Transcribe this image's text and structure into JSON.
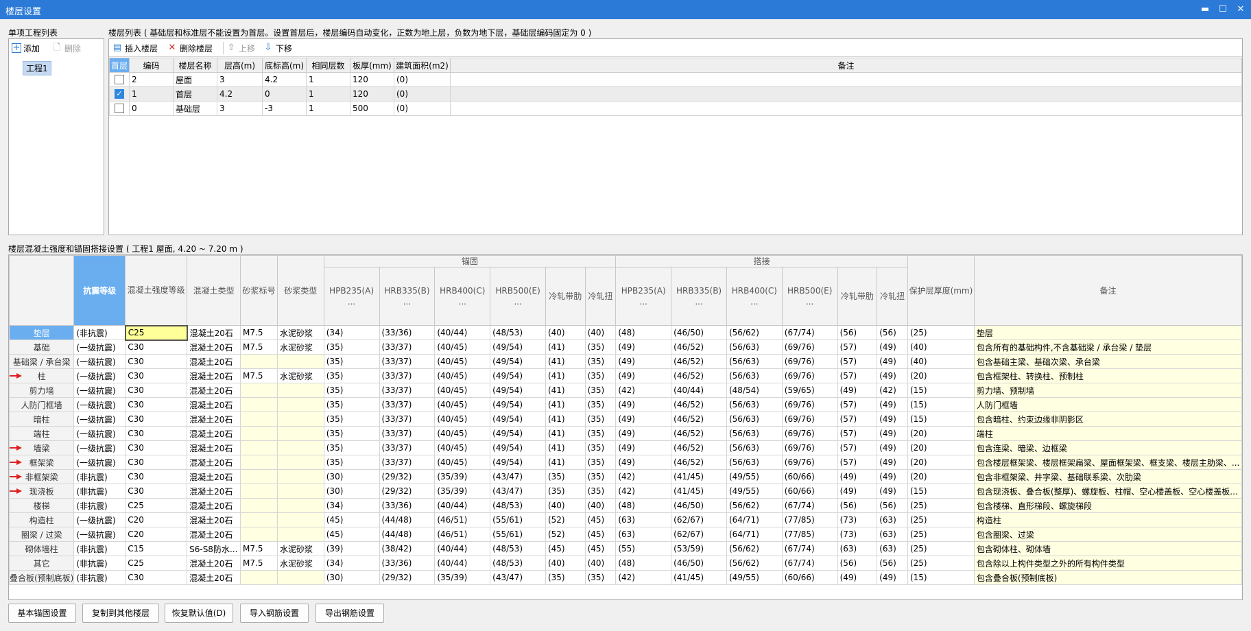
{
  "window": {
    "title": "楼层设置",
    "min": "▬",
    "max": "☐",
    "close": "✕"
  },
  "left": {
    "title": "单项工程列表",
    "add": "添加",
    "delete": "删除",
    "project": "工程1"
  },
  "upper": {
    "title": "楼层列表 ( 基础层和标准层不能设置为首层。设置首层后，楼层编码自动变化，正数为地上层，负数为地下层，基础层编码固定为 0 )",
    "insert": "插入楼层",
    "remove": "删除楼层",
    "up": "上移",
    "down": "下移",
    "columns": [
      "首层",
      "编码",
      "楼层名称",
      "层高(m)",
      "底标高(m)",
      "相同层数",
      "板厚(mm)",
      "建筑面积(m2)",
      "备注"
    ],
    "rows": [
      {
        "checked": false,
        "code": "2",
        "name": "屋面",
        "height": "3",
        "bottom": "4.2",
        "same": "1",
        "slab": "120",
        "area": "(0)",
        "note": ""
      },
      {
        "checked": true,
        "code": "1",
        "name": "首层",
        "height": "4.2",
        "bottom": "0",
        "same": "1",
        "slab": "120",
        "area": "(0)",
        "note": ""
      },
      {
        "checked": false,
        "code": "0",
        "name": "基础层",
        "height": "3",
        "bottom": "-3",
        "same": "1",
        "slab": "500",
        "area": "(0)",
        "note": ""
      }
    ]
  },
  "lower": {
    "title": "楼层混凝土强度和锚固搭接设置 ( 工程1  屋面, 4.20 ~ 7.20 m )",
    "group_anchor": "锚固",
    "group_lap": "搭接",
    "headers": [
      "抗震等级",
      "混凝土强度等级",
      "混凝土类型",
      "砂浆标号",
      "砂浆类型",
      "HPB235(A)\n...",
      "HRB335(B)\n...",
      "HRB400(C)\n...",
      "HRB500(E)\n...",
      "冷轧带肋",
      "冷轧扭",
      "HPB235(A)\n...",
      "HRB335(B)\n...",
      "HRB400(C)\n...",
      "HRB500(E)\n...",
      "冷轧带肋",
      "冷轧扭",
      "保护层厚度(mm)",
      "备注"
    ],
    "rows": [
      {
        "name": "垫层",
        "c": [
          "(非抗震)",
          "C25",
          "混凝土20石",
          "M7.5",
          "水泥砂浆",
          "(34)",
          "(33/36)",
          "(40/44)",
          "(48/53)",
          "(40)",
          "(40)",
          "(48)",
          "(46/50)",
          "(56/62)",
          "(67/74)",
          "(56)",
          "(56)",
          "(25)",
          "垫层"
        ]
      },
      {
        "name": "基础",
        "c": [
          "(一级抗震)",
          "C30",
          "混凝土20石",
          "M7.5",
          "水泥砂浆",
          "(35)",
          "(33/37)",
          "(40/45)",
          "(49/54)",
          "(41)",
          "(35)",
          "(49)",
          "(46/52)",
          "(56/63)",
          "(69/76)",
          "(57)",
          "(49)",
          "(40)",
          "包含所有的基础构件,不含基础梁 / 承台梁 / 垫层"
        ]
      },
      {
        "name": "基础梁 / 承台梁",
        "c": [
          "(一级抗震)",
          "C30",
          "混凝土20石",
          "",
          "",
          "(35)",
          "(33/37)",
          "(40/45)",
          "(49/54)",
          "(41)",
          "(35)",
          "(49)",
          "(46/52)",
          "(56/63)",
          "(69/76)",
          "(57)",
          "(49)",
          "(40)",
          "包含基础主梁、基础次梁、承台梁"
        ]
      },
      {
        "name": "柱",
        "arrow": true,
        "c": [
          "(一级抗震)",
          "C30",
          "混凝土20石",
          "M7.5",
          "水泥砂浆",
          "(35)",
          "(33/37)",
          "(40/45)",
          "(49/54)",
          "(41)",
          "(35)",
          "(49)",
          "(46/52)",
          "(56/63)",
          "(69/76)",
          "(57)",
          "(49)",
          "(20)",
          "包含框架柱、转换柱、预制柱"
        ]
      },
      {
        "name": "剪力墙",
        "c": [
          "(一级抗震)",
          "C30",
          "混凝土20石",
          "",
          "",
          "(35)",
          "(33/37)",
          "(40/45)",
          "(49/54)",
          "(41)",
          "(35)",
          "(42)",
          "(40/44)",
          "(48/54)",
          "(59/65)",
          "(49)",
          "(42)",
          "(15)",
          "剪力墙、预制墙"
        ]
      },
      {
        "name": "人防门框墙",
        "c": [
          "(一级抗震)",
          "C30",
          "混凝土20石",
          "",
          "",
          "(35)",
          "(33/37)",
          "(40/45)",
          "(49/54)",
          "(41)",
          "(35)",
          "(49)",
          "(46/52)",
          "(56/63)",
          "(69/76)",
          "(57)",
          "(49)",
          "(15)",
          "人防门框墙"
        ]
      },
      {
        "name": "暗柱",
        "c": [
          "(一级抗震)",
          "C30",
          "混凝土20石",
          "",
          "",
          "(35)",
          "(33/37)",
          "(40/45)",
          "(49/54)",
          "(41)",
          "(35)",
          "(49)",
          "(46/52)",
          "(56/63)",
          "(69/76)",
          "(57)",
          "(49)",
          "(15)",
          "包含暗柱、约束边缘非阴影区"
        ]
      },
      {
        "name": "端柱",
        "c": [
          "(一级抗震)",
          "C30",
          "混凝土20石",
          "",
          "",
          "(35)",
          "(33/37)",
          "(40/45)",
          "(49/54)",
          "(41)",
          "(35)",
          "(49)",
          "(46/52)",
          "(56/63)",
          "(69/76)",
          "(57)",
          "(49)",
          "(20)",
          "端柱"
        ]
      },
      {
        "name": "墙梁",
        "arrow": true,
        "c": [
          "(一级抗震)",
          "C30",
          "混凝土20石",
          "",
          "",
          "(35)",
          "(33/37)",
          "(40/45)",
          "(49/54)",
          "(41)",
          "(35)",
          "(49)",
          "(46/52)",
          "(56/63)",
          "(69/76)",
          "(57)",
          "(49)",
          "(20)",
          "包含连梁、暗梁、边框梁"
        ]
      },
      {
        "name": "框架梁",
        "arrow": true,
        "c": [
          "(一级抗震)",
          "C30",
          "混凝土20石",
          "",
          "",
          "(35)",
          "(33/37)",
          "(40/45)",
          "(49/54)",
          "(41)",
          "(35)",
          "(49)",
          "(46/52)",
          "(56/63)",
          "(69/76)",
          "(57)",
          "(49)",
          "(20)",
          "包含楼层框架梁、楼层框架扁梁、屋面框架梁、框支梁、楼层主肋梁、..."
        ]
      },
      {
        "name": "非框架梁",
        "arrow": true,
        "c": [
          "(非抗震)",
          "C30",
          "混凝土20石",
          "",
          "",
          "(30)",
          "(29/32)",
          "(35/39)",
          "(43/47)",
          "(35)",
          "(35)",
          "(42)",
          "(41/45)",
          "(49/55)",
          "(60/66)",
          "(49)",
          "(49)",
          "(20)",
          "包含非框架梁、井字梁、基础联系梁、次肋梁"
        ]
      },
      {
        "name": "现浇板",
        "arrow": true,
        "c": [
          "(非抗震)",
          "C30",
          "混凝土20石",
          "",
          "",
          "(30)",
          "(29/32)",
          "(35/39)",
          "(43/47)",
          "(35)",
          "(35)",
          "(42)",
          "(41/45)",
          "(49/55)",
          "(60/66)",
          "(49)",
          "(49)",
          "(15)",
          "包含现浇板、叠合板(整厚)、螺旋板、柱帽、空心楼盖板、空心楼盖板..."
        ]
      },
      {
        "name": "楼梯",
        "c": [
          "(非抗震)",
          "C25",
          "混凝土20石",
          "",
          "",
          "(34)",
          "(33/36)",
          "(40/44)",
          "(48/53)",
          "(40)",
          "(40)",
          "(48)",
          "(46/50)",
          "(56/62)",
          "(67/74)",
          "(56)",
          "(56)",
          "(25)",
          "包含楼梯、直形梯段、螺旋梯段"
        ]
      },
      {
        "name": "构造柱",
        "c": [
          "(一级抗震)",
          "C20",
          "混凝土20石",
          "",
          "",
          "(45)",
          "(44/48)",
          "(46/51)",
          "(55/61)",
          "(52)",
          "(45)",
          "(63)",
          "(62/67)",
          "(64/71)",
          "(77/85)",
          "(73)",
          "(63)",
          "(25)",
          "构造柱"
        ]
      },
      {
        "name": "圈梁 / 过梁",
        "c": [
          "(一级抗震)",
          "C20",
          "混凝土20石",
          "",
          "",
          "(45)",
          "(44/48)",
          "(46/51)",
          "(55/61)",
          "(52)",
          "(45)",
          "(63)",
          "(62/67)",
          "(64/71)",
          "(77/85)",
          "(73)",
          "(63)",
          "(25)",
          "包含圈梁、过梁"
        ]
      },
      {
        "name": "砌体墙柱",
        "c": [
          "(非抗震)",
          "C15",
          "S6-S8防水...",
          "M7.5",
          "水泥砂浆",
          "(39)",
          "(38/42)",
          "(40/44)",
          "(48/53)",
          "(45)",
          "(45)",
          "(55)",
          "(53/59)",
          "(56/62)",
          "(67/74)",
          "(63)",
          "(63)",
          "(25)",
          "包含砌体柱、砌体墙"
        ]
      },
      {
        "name": "其它",
        "c": [
          "(非抗震)",
          "C25",
          "混凝土20石",
          "M7.5",
          "水泥砂浆",
          "(34)",
          "(33/36)",
          "(40/44)",
          "(48/53)",
          "(40)",
          "(40)",
          "(48)",
          "(46/50)",
          "(56/62)",
          "(67/74)",
          "(56)",
          "(56)",
          "(25)",
          "包含除以上构件类型之外的所有构件类型"
        ]
      },
      {
        "name": "叠合板(预制底板)",
        "c": [
          "(非抗震)",
          "C30",
          "混凝土20石",
          "",
          "",
          "(30)",
          "(29/32)",
          "(35/39)",
          "(43/47)",
          "(35)",
          "(35)",
          "(42)",
          "(41/45)",
          "(49/55)",
          "(60/66)",
          "(49)",
          "(49)",
          "(15)",
          "包含叠合板(预制底板)"
        ]
      }
    ]
  },
  "buttons": [
    "基本锚固设置",
    "复制到其他楼层",
    "恢复默认值(D)",
    "导入钢筋设置",
    "导出钢筋设置"
  ],
  "colors": {
    "titlebar": "#2b7ad8",
    "header_selected": "#6aaef0",
    "note_bg": "#ffffe1",
    "highlight": "#ffff99",
    "arrow": "#e02020"
  }
}
